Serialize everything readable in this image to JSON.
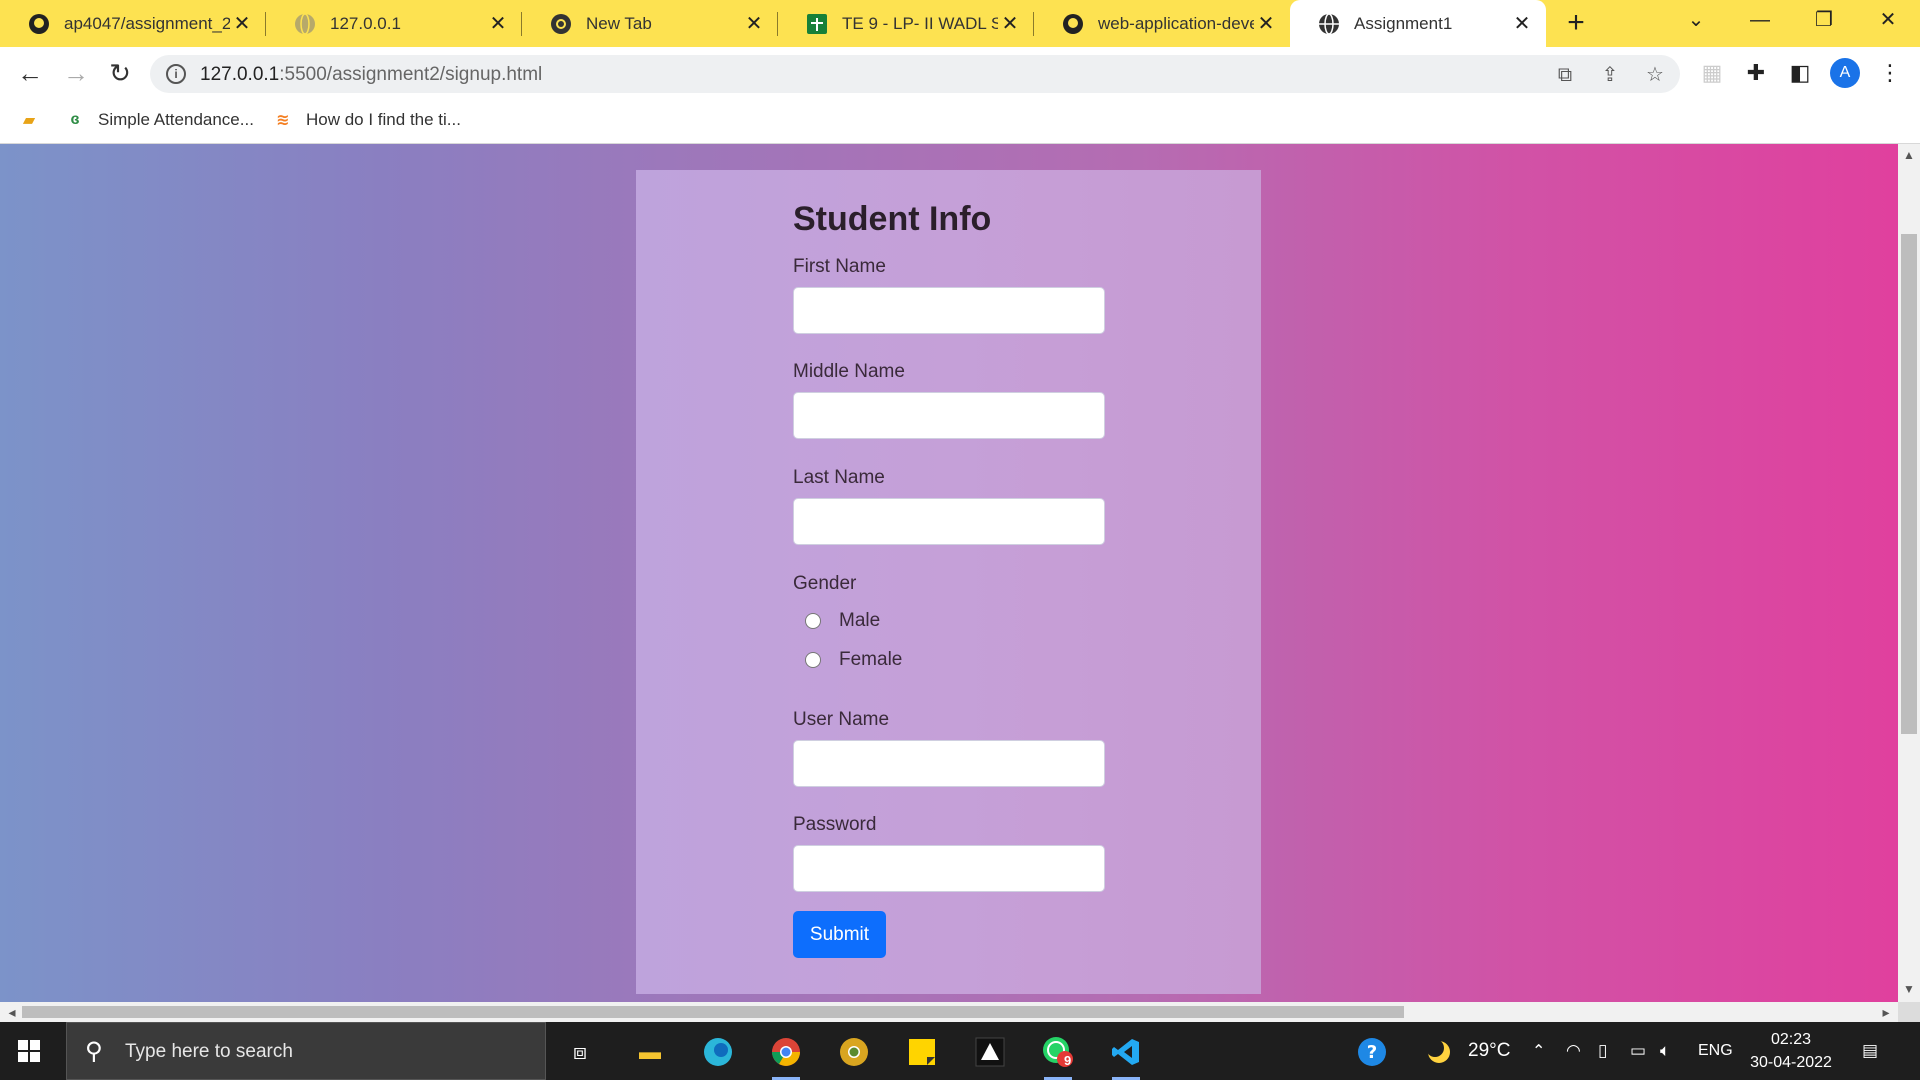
{
  "browser": {
    "tabs": [
      {
        "title": "ap4047/assignment_2",
        "icon": "github-icon"
      },
      {
        "title": "127.0.0.1",
        "icon": "globe-icon"
      },
      {
        "title": "New Tab",
        "icon": "chrome-icon"
      },
      {
        "title": "TE 9 - LP- II WADL Sub",
        "icon": "sheets-icon"
      },
      {
        "title": "web-application-devel",
        "icon": "github-icon"
      },
      {
        "title": "Assignment1",
        "icon": "globe-icon",
        "active": true
      }
    ],
    "new_tab_symbol": "+",
    "window_controls": {
      "dropdown": "⌄",
      "minimize": "—",
      "restore": "❐",
      "close": "✕"
    },
    "address": {
      "host": "127.0.0.1",
      "path": ":5500/assignment2/signup.html"
    },
    "profile_initial": "A",
    "bookmarks": [
      {
        "label": "",
        "icon": "bookmark-book-icon"
      },
      {
        "label": "Simple Attendance...",
        "icon": "geeks-icon"
      },
      {
        "label": "How do I find the ti...",
        "icon": "stackoverflow-icon"
      }
    ]
  },
  "form": {
    "heading": "Student Info",
    "first_name_label": "First Name",
    "middle_name_label": "Middle Name",
    "last_name_label": "Last Name",
    "gender_label": "Gender",
    "gender_options": [
      "Male",
      "Female"
    ],
    "username_label": "User Name",
    "password_label": "Password",
    "submit_label": "Submit"
  },
  "taskbar": {
    "search_placeholder": "Type here to search",
    "whatsapp_badge": "9",
    "temperature": "29°C",
    "language": "ENG",
    "time": "02:23",
    "date": "30-04-2022"
  },
  "colors": {
    "tabstrip": "#fde251",
    "submit": "#0d6efd",
    "card": "#c09fda"
  }
}
